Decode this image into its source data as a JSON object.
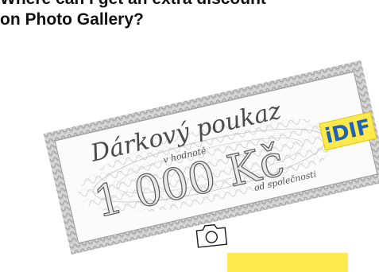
{
  "article": {
    "heading_line1": "Where can I get an extra discount",
    "heading_line2": "on Photo Gallery?"
  },
  "voucher": {
    "title": "Dárkový poukaz",
    "subtitle": "v hodnotě",
    "amount": "1 000 Kč",
    "from_label": "od společnosti",
    "brand_logo": "iDIF",
    "colors": {
      "accent_yellow": "#ffe94d",
      "brand_blue": "#1e63b5",
      "guilloche_gray": "#8a8a8a"
    }
  },
  "cta": {
    "icon": "camera-icon",
    "label": ""
  }
}
